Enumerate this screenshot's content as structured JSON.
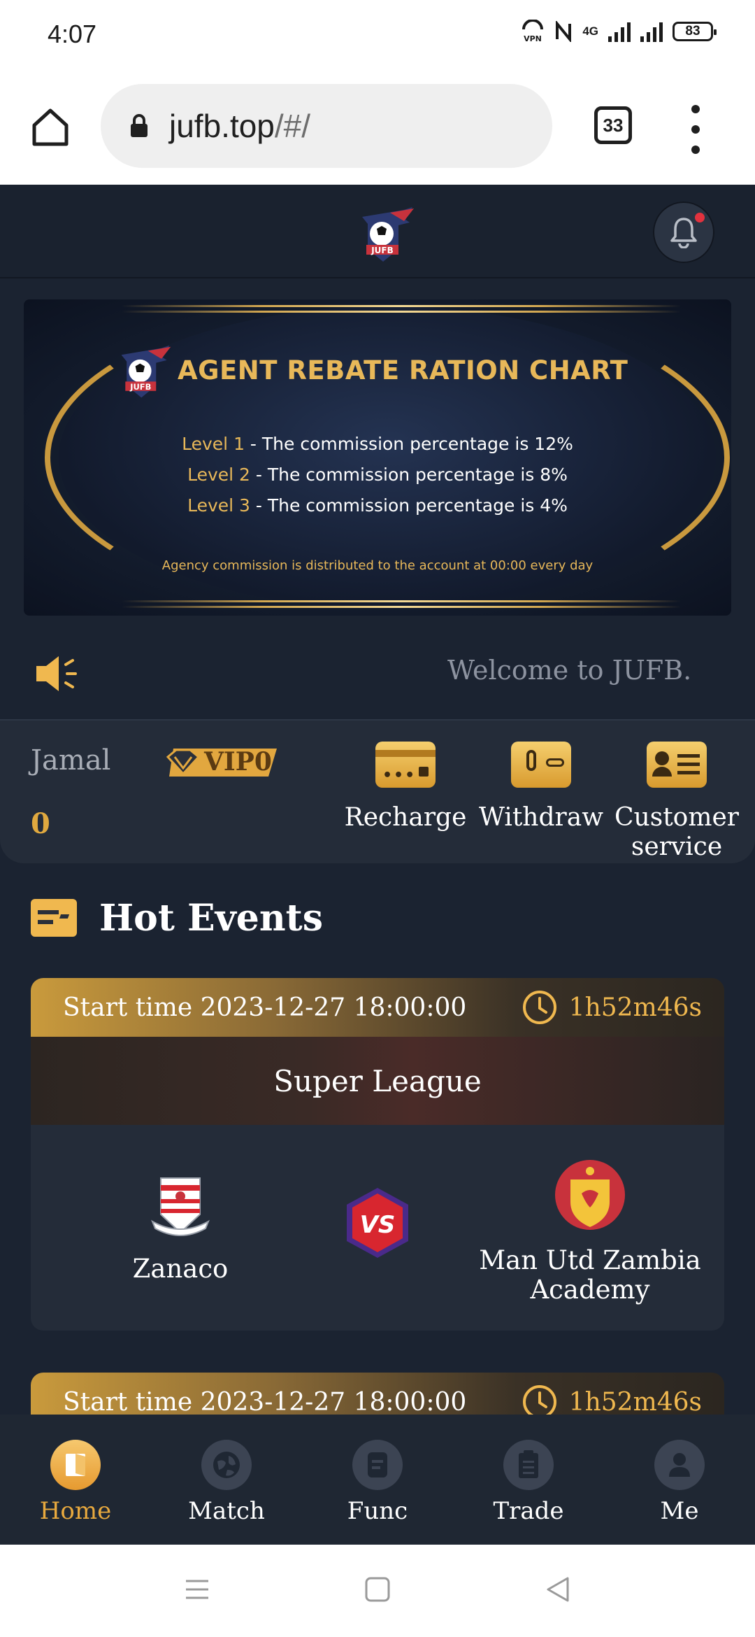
{
  "status_bar": {
    "time": "4:07",
    "network": "4G",
    "battery": "83"
  },
  "browser": {
    "url_main": "jufb.top",
    "url_path": "/#/",
    "tab_count": "33"
  },
  "banner": {
    "title": "AGENT REBATE RATION CHART",
    "levels": [
      {
        "level": "Level 1",
        "text": " - The commission percentage is 12%"
      },
      {
        "level": "Level 2",
        "text": " - The commission percentage is 8%"
      },
      {
        "level": "Level 3",
        "text": " - The commission percentage is 4%"
      }
    ],
    "note": "Agency commission is distributed to the account at 00:00 every day"
  },
  "marquee": {
    "text": "Welcome to JUFB. T"
  },
  "user": {
    "name": "Jamal",
    "vip_label": "VIP0",
    "balance": "0"
  },
  "actions": [
    {
      "label": "Recharge",
      "icon": "card-icon"
    },
    {
      "label": "Withdraw",
      "icon": "wallet-icon"
    },
    {
      "label": "Customer service",
      "icon": "contact-card-icon"
    }
  ],
  "hot_events": {
    "title": "Hot Events",
    "events": [
      {
        "start_label": "Start time 2023-12-27 18:00:00",
        "countdown": "1h52m46s",
        "league": "Super League",
        "home": "Zanaco",
        "away": "Man Utd Zambia Academy",
        "vs": "VS"
      },
      {
        "start_label": "Start time 2023-12-27 18:00:00",
        "countdown": "1h52m46s"
      }
    ]
  },
  "nav": [
    {
      "label": "Home",
      "icon": "home-door-icon",
      "active": true
    },
    {
      "label": "Match",
      "icon": "globe-icon"
    },
    {
      "label": "Func",
      "icon": "document-icon"
    },
    {
      "label": "Trade",
      "icon": "clipboard-icon"
    },
    {
      "label": "Me",
      "icon": "person-icon"
    }
  ],
  "colors": {
    "accent": "#e8a93e",
    "background": "#1b2331",
    "panel": "#242c39"
  }
}
